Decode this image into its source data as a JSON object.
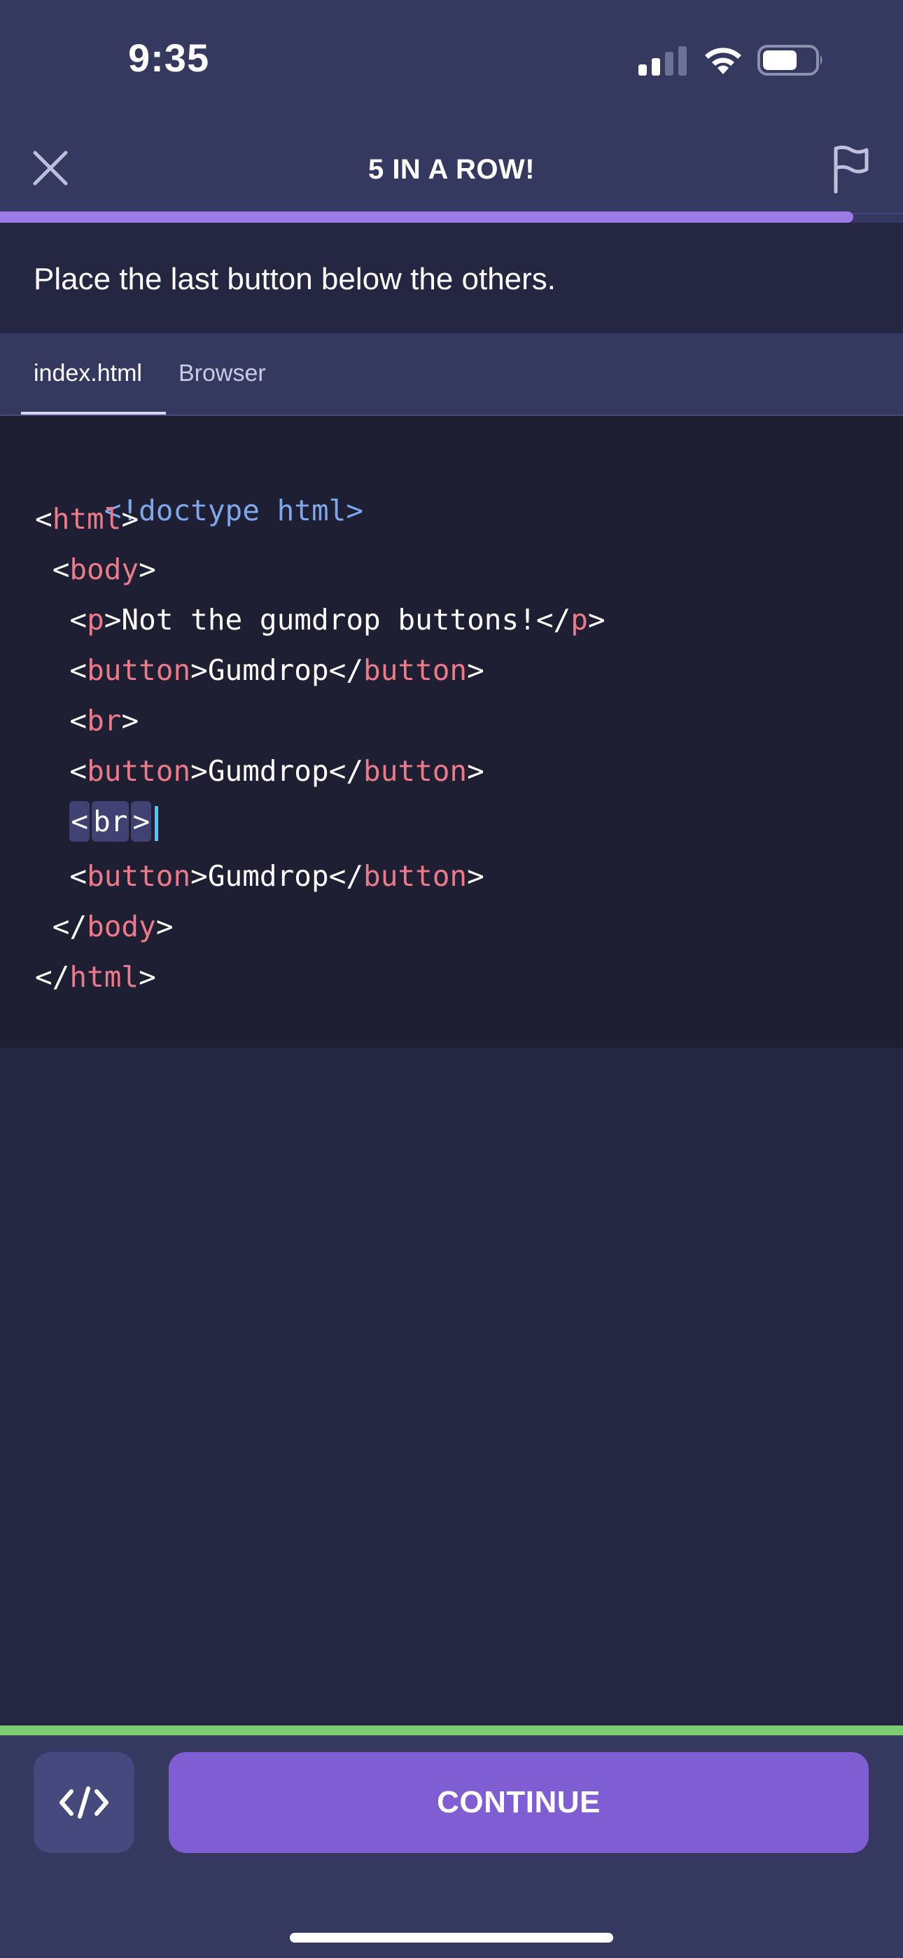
{
  "status_bar": {
    "time": "9:35"
  },
  "header": {
    "title": "5 IN A ROW!",
    "progress_fraction": 0.945,
    "progress_color": "#9b7be6"
  },
  "instruction": {
    "text": "Place the last button below the others."
  },
  "tabs": [
    {
      "label": "index.html",
      "active": true
    },
    {
      "label": "Browser",
      "active": false
    }
  ],
  "code": {
    "l1": {
      "text": "<!doctype html>"
    },
    "l2": {
      "open": "<",
      "tag": "html",
      "close": ">"
    },
    "l3": {
      "indent": " ",
      "open": "<",
      "tag": "body",
      "close": ">"
    },
    "l4": {
      "indent": "  ",
      "open": "<",
      "tag": "p",
      "mid": ">Not the gumdrop buttons!</",
      "tag2": "p",
      "close": ">"
    },
    "l5": {
      "indent": "  ",
      "open": "<",
      "tag": "button",
      "mid": ">Gumdrop</",
      "tag2": "button",
      "close": ">"
    },
    "l6": {
      "indent": "  ",
      "open": "<",
      "tag": "br",
      "close": ">"
    },
    "l7": {
      "indent": "  ",
      "open": "<",
      "tag": "button",
      "mid": ">Gumdrop</",
      "tag2": "button",
      "close": ">"
    },
    "l8": {
      "indent": "  ",
      "open": "<",
      "tag": "br",
      "close": ">"
    },
    "l9": {
      "indent": "  ",
      "open": "<",
      "tag": "button",
      "mid": ">Gumdrop</",
      "tag2": "button",
      "close": ">"
    },
    "l10": {
      "indent": " ",
      "open": "</",
      "tag": "body",
      "close": ">"
    },
    "l11": {
      "open": "</",
      "tag": "html",
      "close": ">"
    }
  },
  "bottom": {
    "continue_label": "CONTINUE",
    "accent_color": "#7ccd71",
    "button_color": "#7f5ed4"
  },
  "icons": {
    "close": "close-icon",
    "flag": "flag-icon",
    "code_toggle": "code-brackets-icon"
  }
}
